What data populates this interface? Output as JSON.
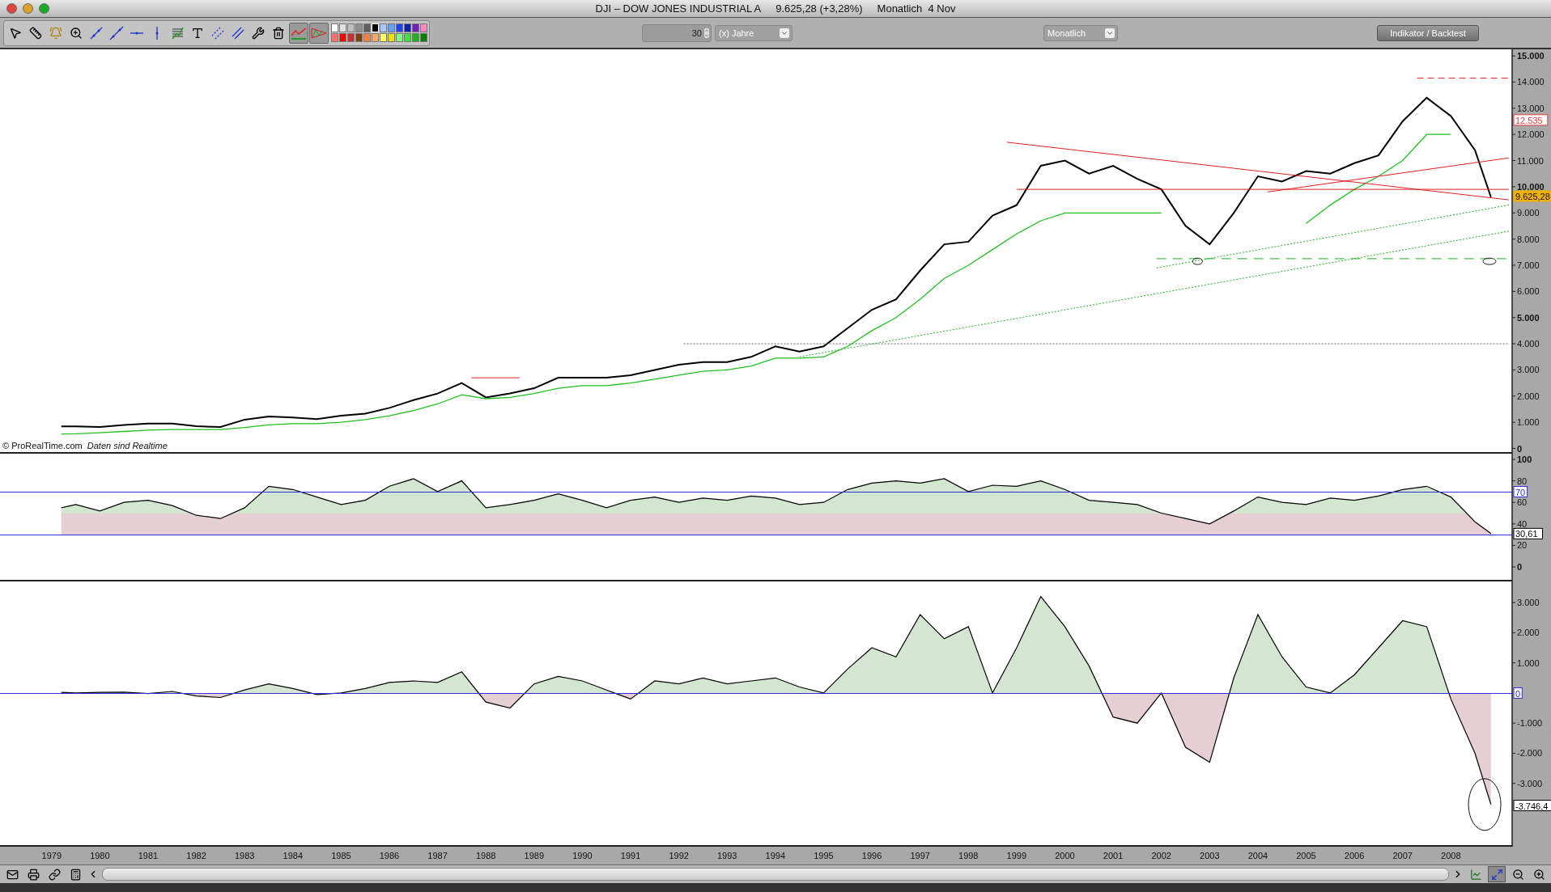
{
  "window": {
    "title": "DJI – DOW JONES INDUSTRIAL A",
    "quote": "9.625,28 (+3,28%)",
    "period": "Monatlich  4 Nov"
  },
  "toolbar": {
    "tools": [
      {
        "kind": "pointer",
        "selected": false
      },
      {
        "kind": "ruler",
        "selected": false
      },
      {
        "kind": "alarm",
        "selected": false
      },
      {
        "kind": "zoom",
        "selected": false
      },
      {
        "kind": "line",
        "selected": false
      },
      {
        "kind": "segment",
        "selected": false
      },
      {
        "kind": "horizontal",
        "selected": false
      },
      {
        "kind": "vertical",
        "selected": false
      },
      {
        "kind": "fib",
        "selected": false
      },
      {
        "kind": "text",
        "selected": false
      },
      {
        "kind": "channel",
        "selected": false
      },
      {
        "kind": "parallel",
        "selected": false
      },
      {
        "kind": "tools",
        "selected": false
      },
      {
        "kind": "trash",
        "selected": false
      },
      {
        "kind": "indicator",
        "selected": true
      },
      {
        "kind": "triangle",
        "selected": true
      }
    ],
    "palette": [
      {
        "color": "#ffffff",
        "selected": false
      },
      {
        "color": "#e0e0e0",
        "selected": false
      },
      {
        "color": "#c0c0c0",
        "selected": false
      },
      {
        "color": "#909090",
        "selected": false
      },
      {
        "color": "#606060",
        "selected": false
      },
      {
        "color": "#000000",
        "selected": true
      },
      {
        "color": "#a8c8ff",
        "selected": false
      },
      {
        "color": "#60a0ff",
        "selected": false
      },
      {
        "color": "#2040ff",
        "selected": false
      },
      {
        "color": "#1020b0",
        "selected": false
      },
      {
        "color": "#7020c0",
        "selected": false
      },
      {
        "color": "#ff88c8",
        "selected": false
      },
      {
        "color": "#ff7070",
        "selected": false
      },
      {
        "color": "#ff0000",
        "selected": false
      },
      {
        "color": "#c83030",
        "selected": false
      },
      {
        "color": "#804010",
        "selected": false
      },
      {
        "color": "#ff8040",
        "selected": false
      },
      {
        "color": "#ffa868",
        "selected": false
      },
      {
        "color": "#ffff60",
        "selected": false
      },
      {
        "color": "#f0e000",
        "selected": false
      },
      {
        "color": "#80ff80",
        "selected": false
      },
      {
        "color": "#40e040",
        "selected": false
      },
      {
        "color": "#20b020",
        "selected": false
      },
      {
        "color": "#008000",
        "selected": false
      }
    ],
    "period_count": "30",
    "period_unit": "(x) Jahre",
    "interval": "Monatlich",
    "indicator_button": "Indikator / Backtest"
  },
  "price_panel": {
    "copyright": "© ProRealTime.com",
    "note": "Daten sind Realtime",
    "value_tags": [
      {
        "text": "12.535",
        "color": "#e04040"
      },
      {
        "text": "9.625,28",
        "color": "#f0b000"
      }
    ],
    "chart_data": {
      "type": "line",
      "xlim": [
        1977.93,
        2009.27
      ],
      "ylim": [
        -200,
        15250
      ],
      "x": [
        1979.2,
        1979.5,
        1980,
        1980.5,
        1981,
        1981.5,
        1982,
        1982.5,
        1983,
        1983.5,
        1984,
        1984.5,
        1985,
        1985.5,
        1986,
        1986.5,
        1987,
        1987.5,
        1988,
        1988.5,
        1989,
        1989.5,
        1990,
        1990.5,
        1991,
        1991.5,
        1992,
        1992.5,
        1993,
        1993.5,
        1994,
        1994.5,
        1995,
        1995.5,
        1996,
        1996.5,
        1997,
        1997.5,
        1998,
        1998.5,
        1999,
        1999.5,
        2000,
        2000.5,
        2001,
        2001.5,
        2002,
        2002.5,
        2003,
        2003.5,
        2004,
        2004.5,
        2005,
        2005.5,
        2006,
        2006.5,
        2007,
        2007.5,
        2008,
        2008.5,
        2008.83
      ],
      "yticks": [
        {
          "value": 15000,
          "label": "15.000"
        },
        {
          "value": 14000,
          "label": "14.000"
        },
        {
          "value": 13000,
          "label": "13.000"
        },
        {
          "value": 12000,
          "label": "12.000"
        },
        {
          "value": 11000,
          "label": "11.000"
        },
        {
          "value": 10000,
          "label": "10.000"
        },
        {
          "value": 9000,
          "label": "9.000"
        },
        {
          "value": 8000,
          "label": "8.000"
        },
        {
          "value": 7000,
          "label": "7.000"
        },
        {
          "value": 6000,
          "label": "6.000"
        },
        {
          "value": 5000,
          "label": "5.000"
        },
        {
          "value": 4000,
          "label": "4.000"
        },
        {
          "value": 3000,
          "label": "3.000"
        },
        {
          "value": 2000,
          "label": "2.000"
        },
        {
          "value": 1000,
          "label": "1.000"
        },
        {
          "value": 0,
          "label": "0"
        }
      ],
      "series": [
        {
          "color": "#000000",
          "values": [
            840,
            840,
            820,
            900,
            950,
            950,
            850,
            820,
            1100,
            1220,
            1180,
            1120,
            1250,
            1330,
            1550,
            1850,
            2100,
            2500,
            1950,
            2100,
            2300,
            2700,
            2700,
            2700,
            2800,
            3000,
            3200,
            3300,
            3300,
            3500,
            3900,
            3700,
            3900,
            4600,
            5300,
            5700,
            6800,
            7800,
            7900,
            8900,
            9300,
            10800,
            11000,
            10500,
            10800,
            10300,
            9900,
            8500,
            7800,
            9000,
            10400,
            10200,
            10600,
            10500,
            10900,
            11200,
            12500,
            13400,
            12700,
            11400,
            9600
          ]
        },
        {
          "color": "#20c020",
          "values": [
            550,
            560,
            600,
            650,
            700,
            720,
            720,
            720,
            800,
            900,
            950,
            950,
            1000,
            1100,
            1250,
            1450,
            1700,
            2050,
            1900,
            1950,
            2100,
            2300,
            2400,
            2400,
            2500,
            2650,
            2800,
            2950,
            3000,
            3150,
            3450,
            3450,
            3500,
            3900,
            4500,
            5000,
            5700,
            6500,
            7000,
            7600,
            8200,
            8700,
            9000,
            9000,
            9000,
            9000,
            9000,
            null,
            null,
            null,
            null,
            null,
            8600,
            9300,
            9900,
            10400,
            11000,
            12000,
            12000,
            null,
            null
          ]
        }
      ]
    }
  },
  "rsi_panel": {
    "value_tags": [
      {
        "text": "30,61",
        "color": "#000000"
      }
    ],
    "chart_data": {
      "type": "area",
      "xlim": [
        1977.93,
        2009.27
      ],
      "ylim": [
        -13.5,
        105.3
      ],
      "x": [
        1979.2,
        1979.5,
        1980,
        1980.5,
        1981,
        1981.5,
        1982,
        1982.5,
        1983,
        1983.5,
        1984,
        1984.5,
        1985,
        1985.5,
        1986,
        1986.5,
        1987,
        1987.5,
        1988,
        1988.5,
        1989,
        1989.5,
        1990,
        1990.5,
        1991,
        1991.5,
        1992,
        1992.5,
        1993,
        1993.5,
        1994,
        1994.5,
        1995,
        1995.5,
        1996,
        1996.5,
        1997,
        1997.5,
        1998,
        1998.5,
        1999,
        1999.5,
        2000,
        2000.5,
        2001,
        2001.5,
        2002,
        2002.5,
        2003,
        2003.5,
        2004,
        2004.5,
        2005,
        2005.5,
        2006,
        2006.5,
        2007,
        2007.5,
        2008,
        2008.5,
        2008.83
      ],
      "yticks": [
        {
          "value": 100,
          "label": "100"
        },
        {
          "value": 80,
          "label": "80"
        },
        {
          "value": 60,
          "label": "60"
        },
        {
          "value": 40,
          "label": "40"
        },
        {
          "value": 20,
          "label": "20"
        },
        {
          "value": 0,
          "label": "0"
        }
      ],
      "ref_lines": [
        {
          "axis": "y",
          "value": 70,
          "label": "70"
        },
        {
          "axis": "y",
          "value": 30
        }
      ],
      "series": [
        {
          "color": "#000000",
          "values": [
            55,
            58,
            52,
            60,
            62,
            57,
            48,
            45,
            55,
            75,
            72,
            65,
            58,
            62,
            75,
            82,
            70,
            80,
            55,
            58,
            62,
            68,
            62,
            55,
            62,
            65,
            60,
            64,
            62,
            66,
            64,
            58,
            60,
            72,
            78,
            80,
            78,
            82,
            70,
            76,
            75,
            80,
            72,
            62,
            60,
            58,
            50,
            45,
            40,
            52,
            65,
            60,
            58,
            64,
            62,
            66,
            72,
            75,
            65,
            42,
            31
          ]
        }
      ]
    }
  },
  "momentum_panel": {
    "value_tags": [
      {
        "text": "-3.746,4",
        "color": "#000000"
      }
    ],
    "chart_data": {
      "type": "area",
      "xlim": [
        1977.93,
        2009.27
      ],
      "ylim": [
        -5100,
        3700
      ],
      "x": [
        1979.2,
        1979.5,
        1980,
        1980.5,
        1981,
        1981.5,
        1982,
        1982.5,
        1983,
        1983.5,
        1984,
        1984.5,
        1985,
        1985.5,
        1986,
        1986.5,
        1987,
        1987.5,
        1988,
        1988.5,
        1989,
        1989.5,
        1990,
        1990.5,
        1991,
        1991.5,
        1992,
        1992.5,
        1993,
        1993.5,
        1994,
        1994.5,
        1995,
        1995.5,
        1996,
        1996.5,
        1997,
        1997.5,
        1998,
        1998.5,
        1999,
        1999.5,
        2000,
        2000.5,
        2001,
        2001.5,
        2002,
        2002.5,
        2003,
        2003.5,
        2004,
        2004.5,
        2005,
        2005.5,
        2006,
        2006.5,
        2007,
        2007.5,
        2008,
        2008.5,
        2008.83
      ],
      "xticks": [
        {
          "value": 1979,
          "label": "1979"
        },
        {
          "value": 1980,
          "label": "1980"
        },
        {
          "value": 1981,
          "label": "1981"
        },
        {
          "value": 1982,
          "label": "1982"
        },
        {
          "value": 1983,
          "label": "1983"
        },
        {
          "value": 1984,
          "label": "1984"
        },
        {
          "value": 1985,
          "label": "1985"
        },
        {
          "value": 1986,
          "label": "1986"
        },
        {
          "value": 1987,
          "label": "1987"
        },
        {
          "value": 1988,
          "label": "1988"
        },
        {
          "value": 1989,
          "label": "1989"
        },
        {
          "value": 1990,
          "label": "1990"
        },
        {
          "value": 1991,
          "label": "1991"
        },
        {
          "value": 1992,
          "label": "1992"
        },
        {
          "value": 1993,
          "label": "1993"
        },
        {
          "value": 1994,
          "label": "1994"
        },
        {
          "value": 1995,
          "label": "1995"
        },
        {
          "value": 1996,
          "label": "1996"
        },
        {
          "value": 1997,
          "label": "1997"
        },
        {
          "value": 1998,
          "label": "1998"
        },
        {
          "value": 1999,
          "label": "1999"
        },
        {
          "value": 2000,
          "label": "2000"
        },
        {
          "value": 2001,
          "label": "2001"
        },
        {
          "value": 2002,
          "label": "2002"
        },
        {
          "value": 2003,
          "label": "2003"
        },
        {
          "value": 2004,
          "label": "2004"
        },
        {
          "value": 2005,
          "label": "2005"
        },
        {
          "value": 2006,
          "label": "2006"
        },
        {
          "value": 2007,
          "label": "2007"
        },
        {
          "value": 2008,
          "label": "2008"
        }
      ],
      "yticks": [
        {
          "value": 3000,
          "label": "3.000"
        },
        {
          "value": 2000,
          "label": "2.000"
        },
        {
          "value": 1000,
          "label": "1.000"
        },
        {
          "value": -1000,
          "label": "-1.000"
        },
        {
          "value": -2000,
          "label": "-2.000"
        },
        {
          "value": -3000,
          "label": "-3.000"
        }
      ],
      "ref_lines": [
        {
          "axis": "y",
          "value": 0,
          "label": "0"
        }
      ],
      "series": [
        {
          "color": "#000000",
          "values": [
            20,
            0,
            20,
            30,
            -20,
            50,
            -100,
            -150,
            100,
            300,
            150,
            -50,
            0,
            150,
            350,
            400,
            350,
            700,
            -300,
            -500,
            300,
            550,
            400,
            100,
            -200,
            400,
            300,
            500,
            300,
            400,
            500,
            200,
            0,
            800,
            1500,
            1200,
            2600,
            1800,
            2200,
            0,
            1500,
            3200,
            2200,
            900,
            -800,
            -1000,
            0,
            -1800,
            -2300,
            500,
            2600,
            1200,
            200,
            0,
            600,
            1500,
            2400,
            2200,
            -200,
            -2000,
            -3700
          ]
        }
      ]
    }
  },
  "bottom_bar": {
    "tools": [
      {
        "kind": "mail",
        "selected": false
      },
      {
        "kind": "print",
        "selected": false
      },
      {
        "kind": "link",
        "selected": false
      },
      {
        "kind": "calc",
        "selected": false
      },
      {
        "kind": "chart",
        "selected": false
      },
      {
        "kind": "zoom-fit",
        "selected": true
      },
      {
        "kind": "zoom-out",
        "selected": false
      },
      {
        "kind": "zoom-in",
        "selected": false
      }
    ]
  }
}
